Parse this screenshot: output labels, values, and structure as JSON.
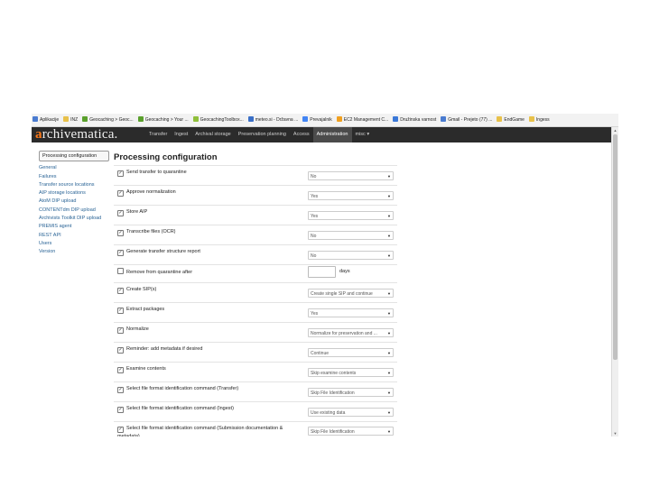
{
  "bookmarks": [
    {
      "label": "Aplikacije",
      "icon": "apps-icon",
      "color": "#4a7bd0"
    },
    {
      "label": "INZ",
      "icon": "folder-icon",
      "color": "#e8c14a"
    },
    {
      "label": "Geocaching > Geoc...",
      "icon": "geocaching-icon",
      "color": "#5aa02c"
    },
    {
      "label": "Geocaching > Your ...",
      "icon": "geocaching-icon",
      "color": "#5aa02c"
    },
    {
      "label": "GeocachingToolbox...",
      "icon": "toolbox-icon",
      "color": "#8fbf3a"
    },
    {
      "label": "meteo.si - Državna ...",
      "icon": "meteo-icon",
      "color": "#3a6fc7"
    },
    {
      "label": "Prevajalnik",
      "icon": "translate-icon",
      "color": "#4285f4"
    },
    {
      "label": "EC2 Management C...",
      "icon": "aws-icon",
      "color": "#f0a020"
    },
    {
      "label": "Družinska varnost",
      "icon": "family-icon",
      "color": "#3a78d8"
    },
    {
      "label": "Gmail - Prejeto (77) ...",
      "icon": "gmail-icon",
      "color": "#4a7bd0"
    },
    {
      "label": "EndGame",
      "icon": "folder-icon",
      "color": "#e8c14a"
    },
    {
      "label": "Ingess",
      "icon": "folder-icon",
      "color": "#e8c14a"
    }
  ],
  "brand": {
    "first": "a",
    "rest": "rchivematica."
  },
  "menu": [
    {
      "label": "Transfer",
      "active": false
    },
    {
      "label": "Ingest",
      "active": false
    },
    {
      "label": "Archival storage",
      "active": false
    },
    {
      "label": "Preservation planning",
      "active": false
    },
    {
      "label": "Access",
      "active": false
    },
    {
      "label": "Administration",
      "active": true
    },
    {
      "label": "misc ▾",
      "active": false
    }
  ],
  "sidebar": [
    {
      "label": "Processing configuration",
      "active": true
    },
    {
      "label": "General"
    },
    {
      "label": "Failures"
    },
    {
      "label": "Transfer source locations"
    },
    {
      "label": "AIP storage locations"
    },
    {
      "label": "AtoM DIP upload"
    },
    {
      "label": "CONTENTdm DIP upload"
    },
    {
      "label": "Archivists Toolkit DIP upload"
    },
    {
      "label": "PREMIS agent"
    },
    {
      "label": "REST API"
    },
    {
      "label": "Users"
    },
    {
      "label": "Version"
    }
  ],
  "page_title": "Processing configuration",
  "rows": [
    {
      "label": "Send transfer to quarantine",
      "checked": true,
      "type": "select",
      "value": "No"
    },
    {
      "label": "Approve normalization",
      "checked": true,
      "type": "select",
      "value": "Yes"
    },
    {
      "label": "Store AIP",
      "checked": true,
      "type": "select",
      "value": "Yes"
    },
    {
      "label": "Transcribe files (OCR)",
      "checked": true,
      "type": "select",
      "value": "No"
    },
    {
      "label": "Generate transfer structure report",
      "checked": true,
      "type": "select",
      "value": "No"
    },
    {
      "label": "Remove from quarantine after",
      "checked": false,
      "type": "text",
      "value": "",
      "unit": "days"
    },
    {
      "label": "Create SIP(s)",
      "checked": true,
      "type": "select",
      "value": "Create single SIP and continue"
    },
    {
      "label": "Extract packages",
      "checked": true,
      "type": "select",
      "value": "Yes"
    },
    {
      "label": "Normalize",
      "checked": true,
      "type": "select",
      "value": "Normalize for preservation and ..."
    },
    {
      "label": "Reminder: add metadata if desired",
      "checked": true,
      "type": "select",
      "value": "Continue"
    },
    {
      "label": "Examine contents",
      "checked": true,
      "type": "select",
      "value": "Skip examine contents"
    },
    {
      "label": "Select file format identification command (Transfer)",
      "checked": true,
      "type": "select",
      "value": "Skip File Identification"
    },
    {
      "label": "Select file format identification command (Ingest)",
      "checked": true,
      "type": "select",
      "value": "Use existing data"
    },
    {
      "label": "Select file format identification command (Submission documentation & metadata)",
      "checked": true,
      "type": "select",
      "value": "Skip File Identification"
    }
  ]
}
